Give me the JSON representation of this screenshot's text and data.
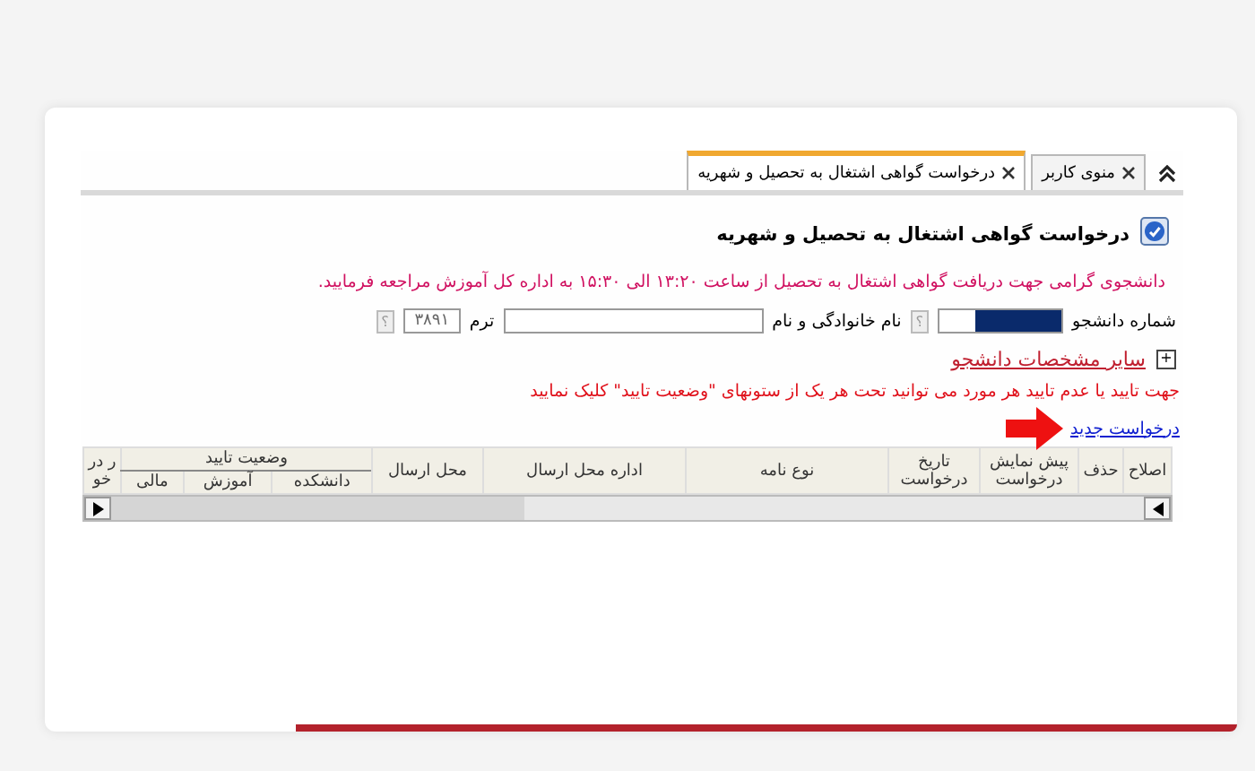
{
  "tabs": [
    {
      "label": "منوی کاربر",
      "selected": false
    },
    {
      "label": "درخواست گواهی اشتغال به تحصیل و شهریه",
      "selected": true
    }
  ],
  "page_title": "درخواست گواهی اشتغال به تحصیل و شهریه",
  "notice": "دانشجوی گرامی جهت دریافت گواهی اشتغال به تحصیل از ساعت ۱۳:۲۰ الی ۱۵:۳۰ به اداره کل آموزش مراجعه فرمایید.",
  "form": [
    {
      "kind": "label",
      "text": "شماره دانشجو"
    },
    {
      "kind": "field",
      "value_hidden": true
    },
    {
      "kind": "help",
      "text": "؟"
    },
    {
      "kind": "label",
      "text": "نام خانوادگی و نام"
    },
    {
      "kind": "field"
    },
    {
      "kind": "label",
      "text": "ترم"
    },
    {
      "kind": "field",
      "value": "۳۸۹۱"
    },
    {
      "kind": "help",
      "text": "؟"
    }
  ],
  "more_section": {
    "expand_sign": "+",
    "label": "سایر مشخصات دانشجو",
    "expanded": false
  },
  "instruction": "جهت تایید یا عدم تایید هر مورد می توانید تحت هر یک از ستونهای \"وضعیت تایید\" کلیک نمایید",
  "new_request_link": "درخواست جدید",
  "table": {
    "columns": [
      {
        "label": "اصلاح"
      },
      {
        "label": "حذف"
      },
      {
        "label": "پیش نمایش درخواست"
      },
      {
        "label": "تاریخ درخواست"
      },
      {
        "label": "نوع نامه"
      },
      {
        "label": "اداره محل ارسال"
      },
      {
        "label": "محل ارسال"
      },
      {
        "label": "وضعیت تایید",
        "children": [
          {
            "label": "دانشکده"
          },
          {
            "label": "آموزش"
          },
          {
            "label": "مالی"
          }
        ]
      },
      {
        "label": "ر درخو"
      }
    ]
  }
}
